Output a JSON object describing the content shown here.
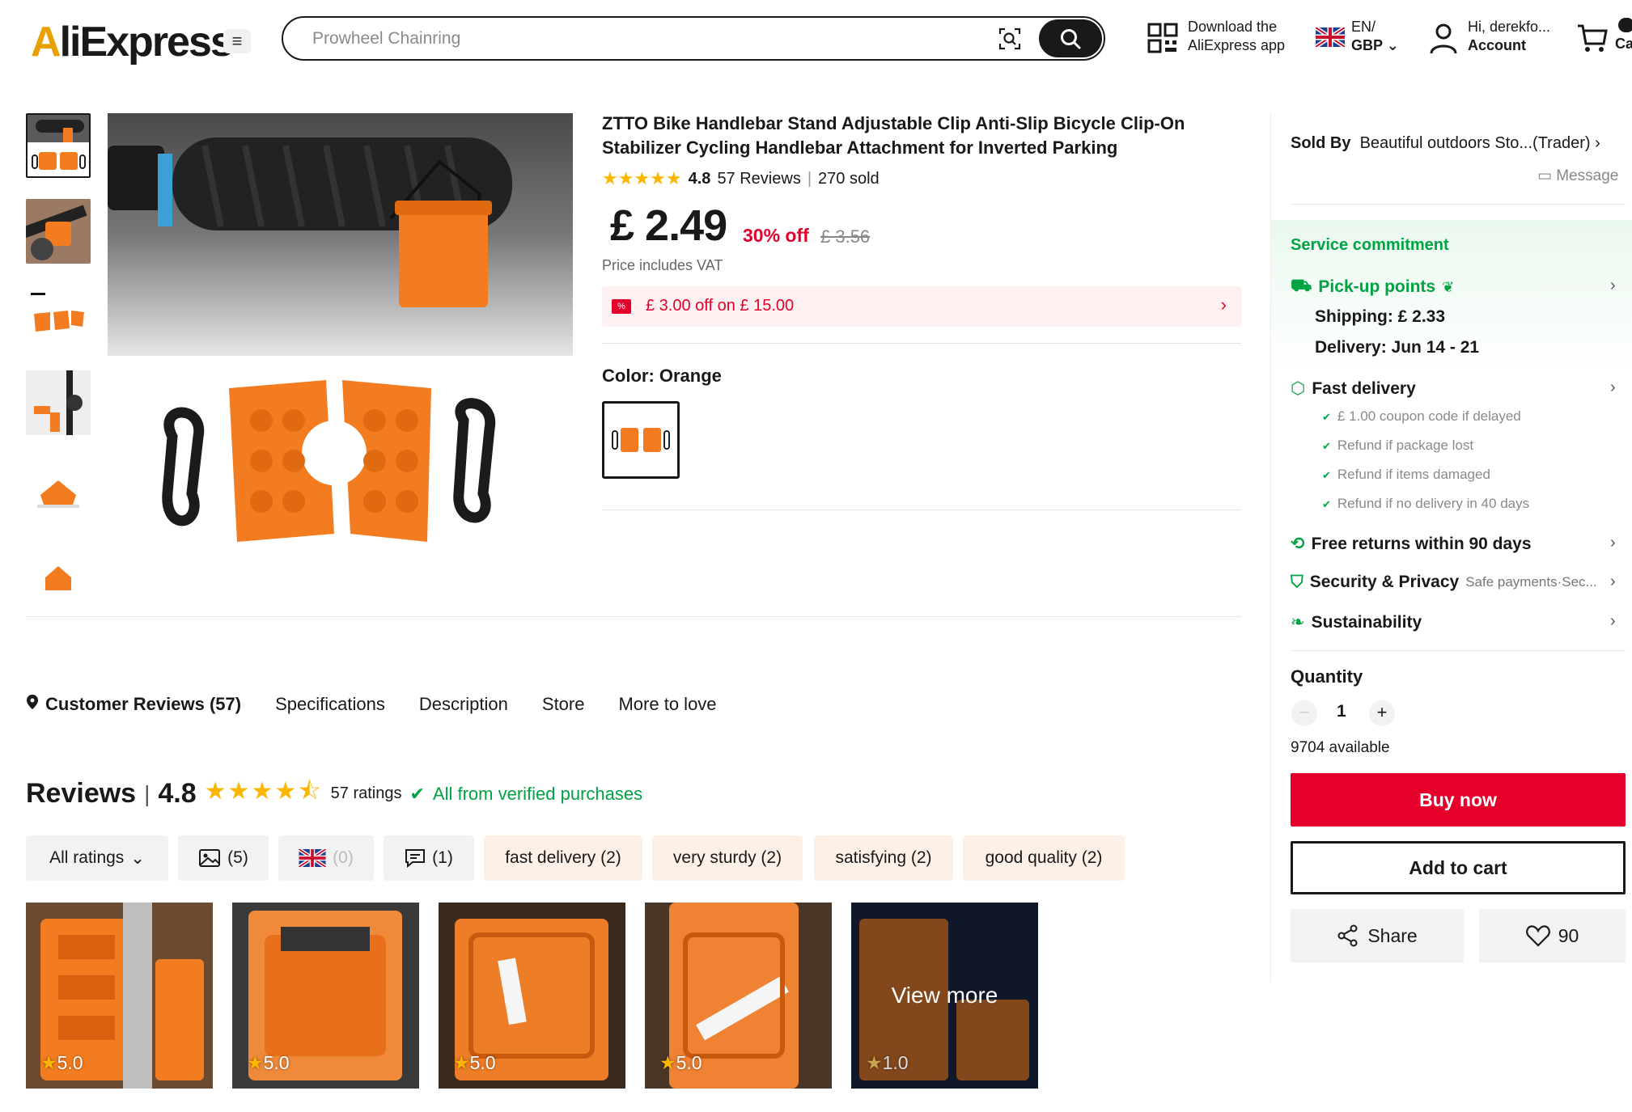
{
  "header": {
    "logo": "AliExpress",
    "search_placeholder": "Prowheel Chainring",
    "download_line1": "Download the",
    "download_line2": "AliExpress app",
    "lang_line1": "EN/",
    "lang_line2": "GBP",
    "account_line1": "Hi, derekfo...",
    "account_line2": "Account",
    "cart_label": "Ca"
  },
  "product": {
    "title": "ZTTO Bike Handlebar Stand Adjustable Clip Anti-Slip Bicycle Clip-On Stabilizer Cycling Handlebar Attachment for Inverted Parking",
    "rating": "4.8",
    "reviews": "57 Reviews",
    "sold": "270 sold",
    "price": "£ 2.49",
    "discount": "30% off",
    "old_price": "£ 3.56",
    "vat": "Price includes VAT",
    "coupon": "£ 3.00 off on £ 15.00",
    "color_label": "Color: Orange"
  },
  "panel": {
    "sold_by_label": "Sold By",
    "seller": "Beautiful outdoors Sto...(Trader)",
    "message": "Message",
    "service_title": "Service commitment",
    "pickup": "Pick-up points",
    "shipping": "Shipping: £ 2.33",
    "delivery": "Delivery: Jun 14 - 21",
    "fast_delivery": "Fast delivery",
    "fast_items": [
      "£ 1.00 coupon code if delayed",
      "Refund if package lost",
      "Refund if items damaged",
      "Refund if no delivery in 40 days"
    ],
    "free_returns": "Free returns within 90 days",
    "security": "Security & Privacy",
    "security_sub": "Safe payments·Sec...",
    "sustainability": "Sustainability",
    "quantity_label": "Quantity",
    "quantity_value": "1",
    "available": "9704 available",
    "buy_now": "Buy now",
    "add_to_cart": "Add to cart",
    "share": "Share",
    "wishlist_count": "90"
  },
  "tabs": [
    "Customer Reviews (57)",
    "Specifications",
    "Description",
    "Store",
    "More to love"
  ],
  "reviews": {
    "title": "Reviews",
    "score": "4.8",
    "ratings": "57 ratings",
    "verified": "All from verified purchases",
    "filters": {
      "all": "All ratings",
      "photos": "(5)",
      "uk": "(0)",
      "comments": "(1)",
      "tags": [
        "fast delivery (2)",
        "very sturdy (2)",
        "satisfying (2)",
        "good quality (2)"
      ]
    },
    "images": [
      {
        "rating": "5.0"
      },
      {
        "rating": "5.0"
      },
      {
        "rating": "5.0"
      },
      {
        "rating": "5.0"
      },
      {
        "rating": "1.0",
        "overlay": "View more"
      }
    ]
  },
  "colors": {
    "accent_red": "#e4002b",
    "green": "#00a341",
    "star": "#fdb600",
    "orange": "#f47c20"
  }
}
